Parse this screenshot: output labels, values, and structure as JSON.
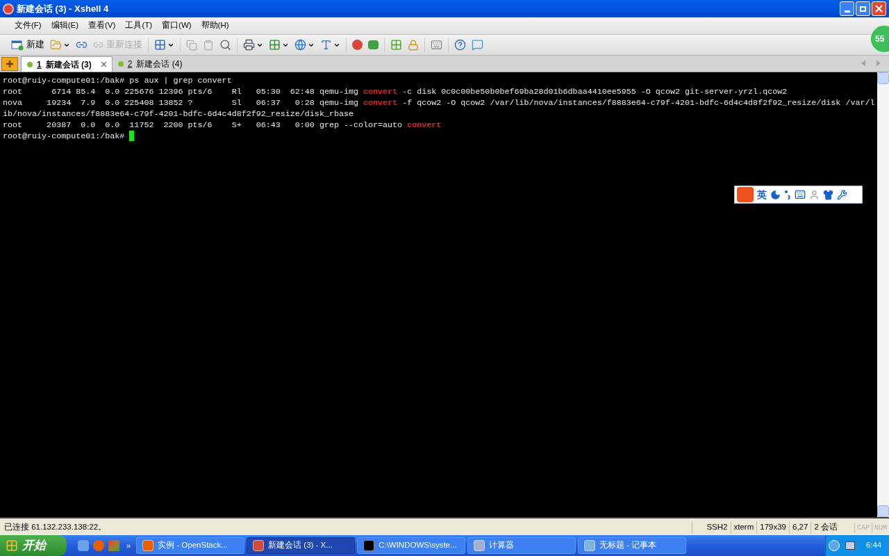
{
  "window": {
    "title": "新建会话 (3) - Xshell 4"
  },
  "menu": [
    "文件(F)",
    "编辑(E)",
    "查看(V)",
    "工具(T)",
    "窗口(W)",
    "帮助(H)"
  ],
  "toolbar": {
    "new_label": "新建",
    "reconnect": {
      "label": "重新连接",
      "disabled": true
    }
  },
  "badge": "55",
  "tabs": [
    {
      "number": "1",
      "label": "新建会话 (3)",
      "selected": true
    },
    {
      "number": "2",
      "label": "新建会话 (4)",
      "selected": false
    }
  ],
  "terminal": {
    "lines": [
      [
        {
          "kind": "plain",
          "text": "root@ruiy-compute01:/bak# ps aux | grep convert"
        }
      ],
      [
        {
          "kind": "plain",
          "text": "root      6714 85.4  0.0 225676 12396 pts/6    Rl   05:30  62:48 qemu-img "
        },
        {
          "kind": "match",
          "text": "convert"
        },
        {
          "kind": "plain",
          "text": " -c disk 0c0c00be50b0bef69ba28d01b6dbaa4410ee5955 -O qcow2 git-server-yrzl.qcow2"
        }
      ],
      [
        {
          "kind": "plain",
          "text": "nova     19234  7.9  0.0 225408 13852 ?        Sl   06:37   0:28 qemu-img "
        },
        {
          "kind": "match",
          "text": "convert"
        },
        {
          "kind": "plain",
          "text": " -f qcow2 -O qcow2 /var/lib/nova/instances/f8883e64-c79f-4201-bdfc-6d4c4d8f2f92_resize/disk /var/l"
        }
      ],
      [
        {
          "kind": "plain",
          "text": "ib/nova/instances/f8883e64-c79f-4201-bdfc-6d4c4d8f2f92_resize/disk_rbase"
        }
      ],
      [
        {
          "kind": "plain",
          "text": "root     20387  0.0  0.0  11752  2200 pts/6    S+   06:43   0:00 grep --color=auto "
        },
        {
          "kind": "match",
          "text": "convert"
        }
      ],
      [
        {
          "kind": "plain",
          "text": "root@ruiy-compute01:/bak# "
        },
        {
          "kind": "cursor"
        }
      ]
    ]
  },
  "ime_bar": {
    "mode": "英"
  },
  "status_bar": {
    "message": "已连接 61.132.233.138:22。",
    "cells": [
      "SSH2",
      "xterm",
      "179x39",
      "6,27",
      "2 会话"
    ],
    "indicators": [
      {
        "label": "CAP",
        "on": false
      },
      {
        "label": "NUM",
        "on": false
      }
    ]
  },
  "taskbar": {
    "start": "开始",
    "more": "»",
    "tasks": [
      {
        "label": "实例 - OpenStack...",
        "selected": false
      },
      {
        "label": "新建会话 (3) - X...",
        "selected": true
      },
      {
        "label": "C:\\WINDOWS\\syste...",
        "selected": false
      },
      {
        "label": "计算器",
        "selected": false
      },
      {
        "label": "无标题 - 记事本",
        "selected": false
      }
    ],
    "clock": "6:44"
  }
}
